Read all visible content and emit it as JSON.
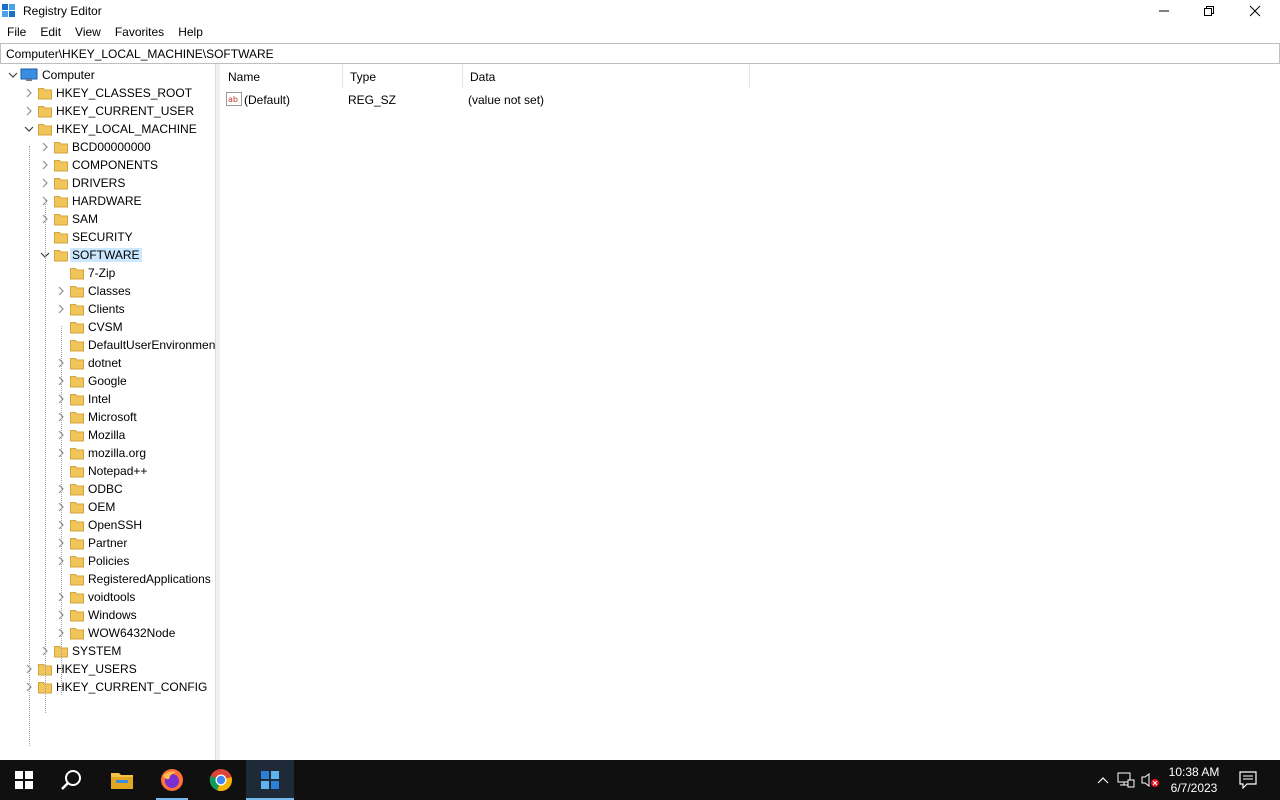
{
  "window": {
    "title": "Registry Editor",
    "icons": {
      "app": "registry-icon",
      "minimize": "minimize-icon",
      "maximize": "restore-icon",
      "close": "close-icon"
    }
  },
  "menu": [
    "File",
    "Edit",
    "View",
    "Favorites",
    "Help"
  ],
  "address": "Computer\\HKEY_LOCAL_MACHINE\\SOFTWARE",
  "tree": {
    "root": "Computer",
    "hives": [
      "HKEY_CLASSES_ROOT",
      "HKEY_CURRENT_USER",
      "HKEY_LOCAL_MACHINE",
      "HKEY_USERS",
      "HKEY_CURRENT_CONFIG"
    ],
    "hklm_children": [
      "BCD00000000",
      "COMPONENTS",
      "DRIVERS",
      "HARDWARE",
      "SAM",
      "SECURITY",
      "SOFTWARE",
      "SYSTEM"
    ],
    "software_children": [
      "7-Zip",
      "Classes",
      "Clients",
      "CVSM",
      "DefaultUserEnvironmen",
      "dotnet",
      "Google",
      "Intel",
      "Microsoft",
      "Mozilla",
      "mozilla.org",
      "Notepad++",
      "ODBC",
      "OEM",
      "OpenSSH",
      "Partner",
      "Policies",
      "RegisteredApplications",
      "voidtools",
      "Windows",
      "WOW6432Node"
    ],
    "selected": "SOFTWARE"
  },
  "list": {
    "columns": [
      "Name",
      "Type",
      "Data"
    ],
    "rows": [
      {
        "name": "(Default)",
        "type": "REG_SZ",
        "data": "(value not set)"
      }
    ]
  },
  "taskbar": {
    "apps": [
      "start-icon",
      "search-icon",
      "file-explorer-icon",
      "firefox-icon",
      "chrome-icon",
      "registry-editor-icon"
    ],
    "tray": [
      "chevron-up-icon",
      "network-icon",
      "volume-muted-icon",
      "notification-icon"
    ],
    "time": "10:38 AM",
    "date": "6/7/2023"
  },
  "colors": {
    "selection": "#cce8ff",
    "folder": "#f0c65a",
    "taskbar": "#101010",
    "accent": "#76b9ed"
  }
}
